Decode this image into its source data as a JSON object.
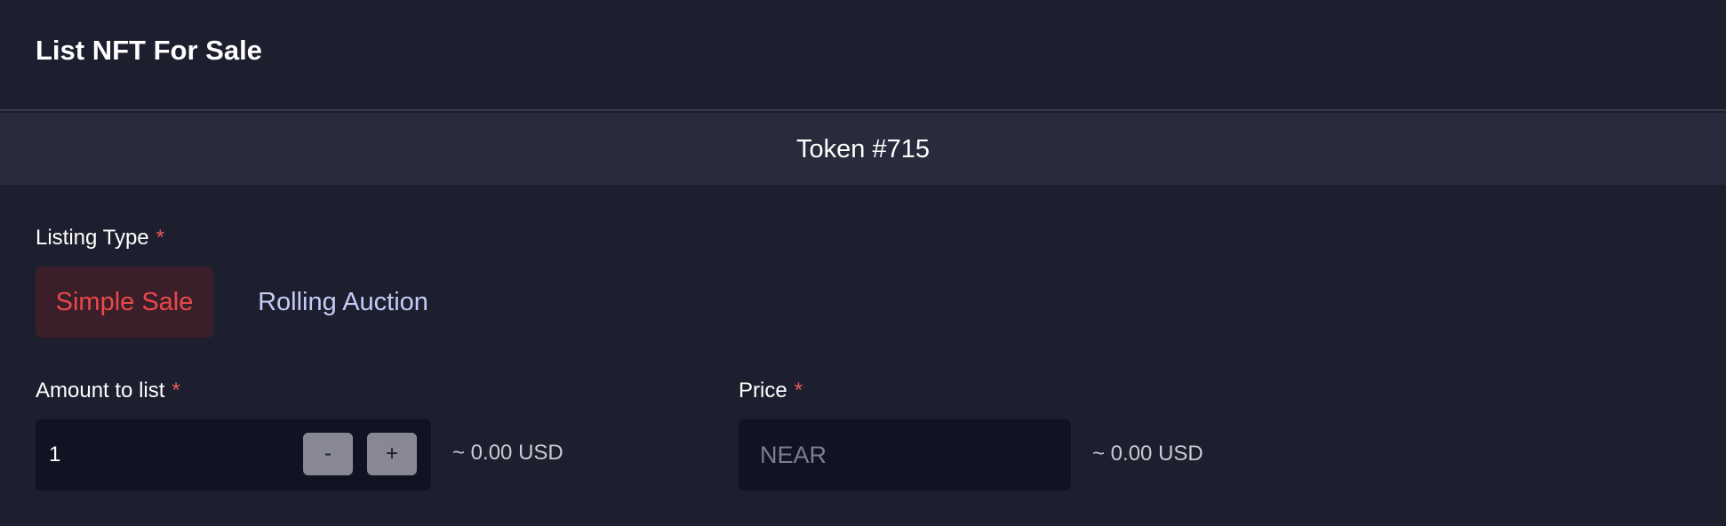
{
  "header": {
    "title": "List NFT For Sale"
  },
  "token": {
    "name": "Token #715"
  },
  "listing_type": {
    "label": "Listing Type",
    "required_mark": "*",
    "options": [
      {
        "label": "Simple Sale",
        "selected": true
      },
      {
        "label": "Rolling Auction",
        "selected": false
      }
    ]
  },
  "amount": {
    "label": "Amount to list",
    "required_mark": "*",
    "value": "1",
    "minus_label": "-",
    "plus_label": "+",
    "usd_estimate": "~ 0.00 USD"
  },
  "price": {
    "label": "Price",
    "required_mark": "*",
    "value": "",
    "placeholder": "NEAR",
    "usd_estimate": "~ 0.00 USD"
  },
  "colors": {
    "background": "#1e1f2e",
    "token_bar": "#292a3b",
    "input_bg": "#121322",
    "accent_red": "#e94848",
    "selected_bg": "#3a1f2a",
    "unselected_text": "#c5cbf7",
    "stepper_bg": "#878894",
    "required_mark": "#e85a5a"
  }
}
